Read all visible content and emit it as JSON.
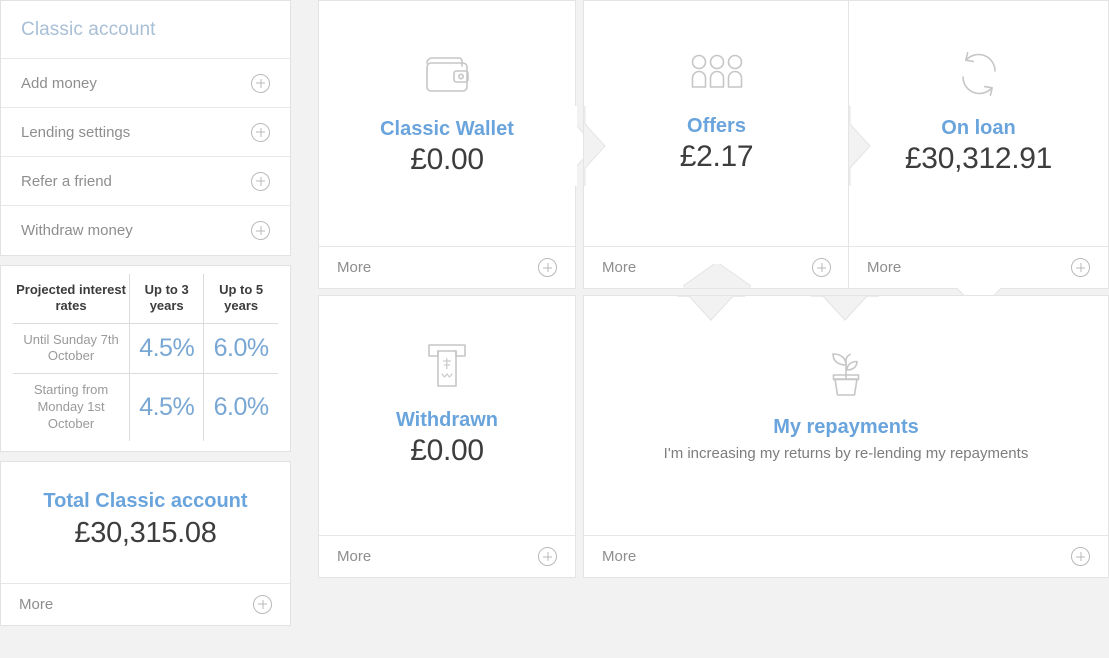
{
  "colors": {
    "accent_blue": "#6aa4dc",
    "rate_blue": "#79a7d4",
    "header_blue": "#a8bfd6",
    "text_dark": "#3d3d3d",
    "text_grey": "#8d8d8d",
    "page_bg": "#f2f2f2",
    "card_bg": "#ffffff",
    "border": "#e4e4e4"
  },
  "sidebar": {
    "header": "Classic account",
    "items": [
      {
        "label": "Add money",
        "icon": "plus-circle-icon"
      },
      {
        "label": "Lending settings",
        "icon": "plus-circle-icon"
      },
      {
        "label": "Refer a friend",
        "icon": "plus-circle-icon"
      },
      {
        "label": "Withdraw money",
        "icon": "plus-circle-icon"
      }
    ],
    "rates": {
      "headers": [
        "Projected interest rates",
        "Up to 3 years",
        "Up to 5 years"
      ],
      "rows": [
        {
          "period": "Until Sunday 7th October",
          "up_to_3_years": "4.5%",
          "up_to_5_years": "6.0%"
        },
        {
          "period": "Starting from Monday 1st October",
          "up_to_3_years": "4.5%",
          "up_to_5_years": "6.0%"
        }
      ]
    },
    "total": {
      "title": "Total Classic account",
      "amount": "£30,315.08",
      "more_label": "More",
      "more_icon": "plus-circle-icon"
    }
  },
  "cards": {
    "wallet": {
      "title": "Classic Wallet",
      "amount": "£0.00",
      "icon": "wallet-icon",
      "more_label": "More",
      "more_icon": "plus-circle-icon"
    },
    "offers": {
      "title": "Offers",
      "amount": "£2.17",
      "icon": "people-group-icon",
      "more_label": "More",
      "more_icon": "plus-circle-icon"
    },
    "onloan": {
      "title": "On loan",
      "amount": "£30,312.91",
      "icon": "cycle-arrows-icon",
      "more_label": "More",
      "more_icon": "plus-circle-icon"
    },
    "withdrawn": {
      "title": "Withdrawn",
      "amount": "£0.00",
      "icon": "atm-cash-icon",
      "more_label": "More",
      "more_icon": "plus-circle-icon"
    },
    "repayments": {
      "title": "My repayments",
      "subtitle": "I'm increasing my returns by re-lending my repayments",
      "icon": "potted-plant-icon",
      "more_label": "More",
      "more_icon": "plus-circle-icon"
    }
  }
}
